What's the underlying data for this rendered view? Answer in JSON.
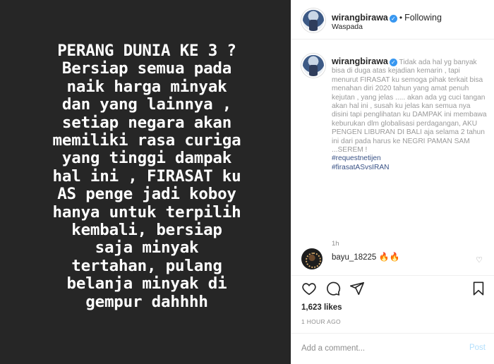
{
  "post": {
    "image_text_lines": [
      "PERANG DUNIA KE 3 ?",
      "Bersiap semua pada",
      "naik harga minyak",
      "dan yang lainnya ,",
      "setiap negara akan",
      "memiliki rasa curiga",
      "yang tinggi dampak",
      "hal ini , FIRASAT ku",
      "AS penge jadi koboy",
      "hanya untuk terpilih",
      "kembali, bersiap",
      "saja minyak",
      "tertahan, pulang",
      "belanja minyak di",
      "gempur dahhhh"
    ]
  },
  "header": {
    "username": "wirangbirawa",
    "verified_mark": "✓",
    "separator": "•",
    "follow_status": "Following",
    "location": "Waspada",
    "more_icon": "•••"
  },
  "caption": {
    "username": "wirangbirawa",
    "verified_mark": "✓",
    "text": "Tidak ada hal yg banyak bisa di duga atas kejadian kemarin , tapi menurut FIRASAT ku semoga pihak terkait bisa menahan diri 2020 tahun yang amat penuh kejutan , yang jelas ..... akan ada yg cuci tangan akan hal ini , susah ku jelas kan semua nya disini tapi penglihatan ku DAMPAK ini membawa keburukan dlm globalisasi perdagangan, AKU PENGEN LIBURAN DI BALI aja selama 2 tahun ini dari pada harus ke NEGRI PAMAN SAM ...SEREM !",
    "hashtags": [
      "#requestnetijen",
      "#firasatASvsIRAN"
    ],
    "age": "1h"
  },
  "comment": {
    "username": "bayu_18225",
    "text": "🔥🔥",
    "like_icon": "♡"
  },
  "stats": {
    "likes": "1,623 likes",
    "time_ago": "1 HOUR AGO"
  },
  "composer": {
    "placeholder": "Add a comment...",
    "post_label": "Post"
  },
  "icons": [
    "heart-icon",
    "comment-icon",
    "share-icon",
    "bookmark-icon",
    "more-icon",
    "verified-icon"
  ],
  "colors": {
    "media_background": "#262626",
    "verified": "#3897f0",
    "hashtag": "#385185",
    "muted": "#8e8e8e",
    "post_disabled": "#b2dffc"
  }
}
